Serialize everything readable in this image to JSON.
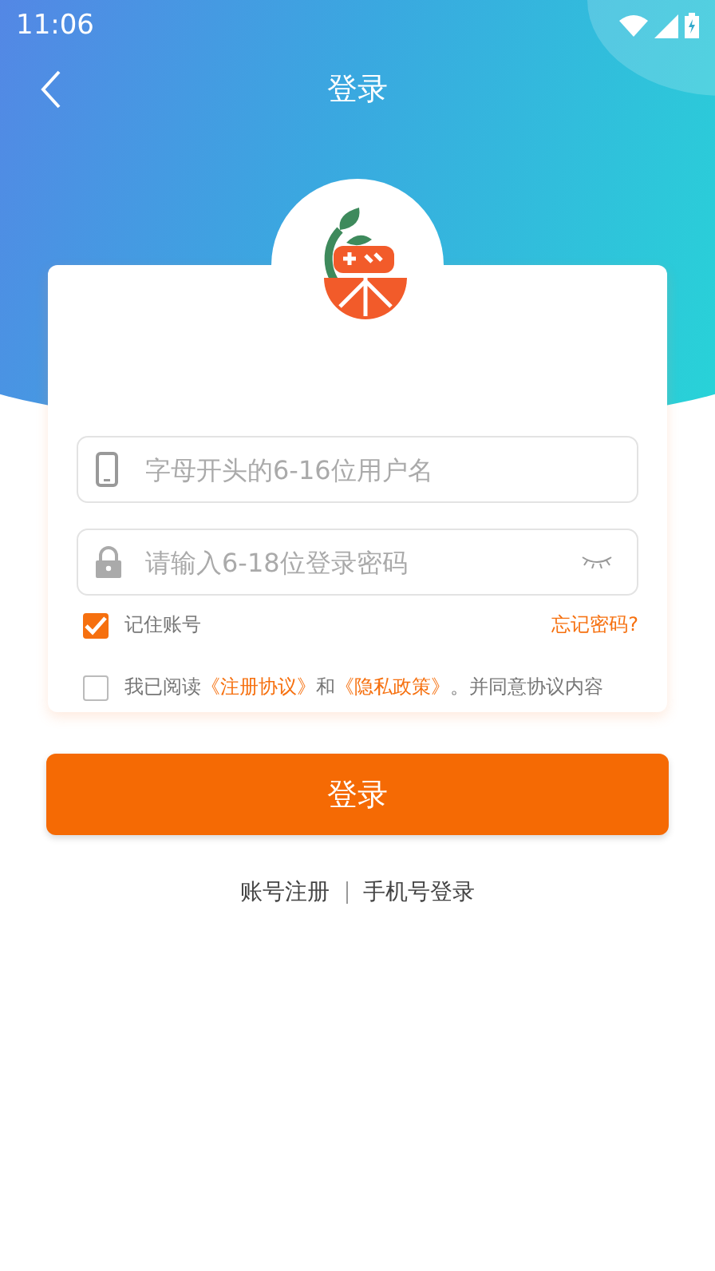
{
  "status_bar": {
    "time": "11:06"
  },
  "nav": {
    "title": "登录"
  },
  "form": {
    "username": {
      "placeholder": "字母开头的6-16位用户名"
    },
    "password": {
      "placeholder": "请输入6-18位登录密码"
    },
    "remember": {
      "label": "记住账号",
      "checked": true
    },
    "forgot": "忘记密码?",
    "agreement": {
      "checked": false,
      "parts": [
        {
          "kind": "text",
          "text": "我已阅读"
        },
        {
          "kind": "link",
          "text": "《注册协议》"
        },
        {
          "kind": "text",
          "text": "和"
        },
        {
          "kind": "link",
          "text": "《隐私政策》"
        },
        {
          "kind": "text",
          "text": "。并同意协议内容"
        }
      ]
    }
  },
  "login_button": "登录",
  "links": [
    "账号注册",
    "手机号登录"
  ]
}
